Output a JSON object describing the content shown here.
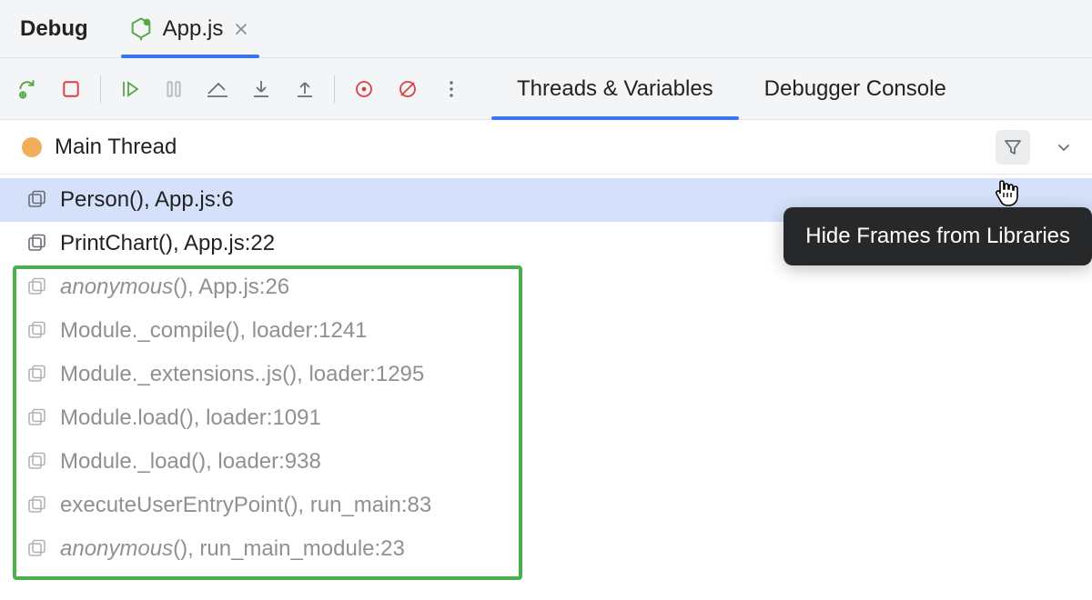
{
  "topTabs": {
    "debugLabel": "Debug",
    "fileLabel": "App.js"
  },
  "subTabs": {
    "threadsLabel": "Threads & Variables",
    "consoleLabel": "Debugger Console"
  },
  "thread": {
    "name": "Main Thread"
  },
  "tooltip": "Hide Frames from Libraries",
  "frames": [
    {
      "label": "Person(), App.js:6",
      "selected": true,
      "dim": false,
      "italic": false
    },
    {
      "label": "PrintChart(), App.js:22",
      "selected": false,
      "dim": false,
      "italic": false
    },
    {
      "labelItalic": "anonymous",
      "labelRest": "(), App.js:26",
      "selected": false,
      "dim": true,
      "italic": true
    },
    {
      "label": "Module._compile(), loader:1241",
      "selected": false,
      "dim": true,
      "italic": false
    },
    {
      "label": "Module._extensions..js(), loader:1295",
      "selected": false,
      "dim": true,
      "italic": false
    },
    {
      "label": "Module.load(), loader:1091",
      "selected": false,
      "dim": true,
      "italic": false
    },
    {
      "label": "Module._load(), loader:938",
      "selected": false,
      "dim": true,
      "italic": false
    },
    {
      "label": "executeUserEntryPoint(), run_main:83",
      "selected": false,
      "dim": true,
      "italic": false
    },
    {
      "labelItalic": "anonymous",
      "labelRest": "(), run_main_module:23",
      "selected": false,
      "dim": true,
      "italic": true
    }
  ]
}
